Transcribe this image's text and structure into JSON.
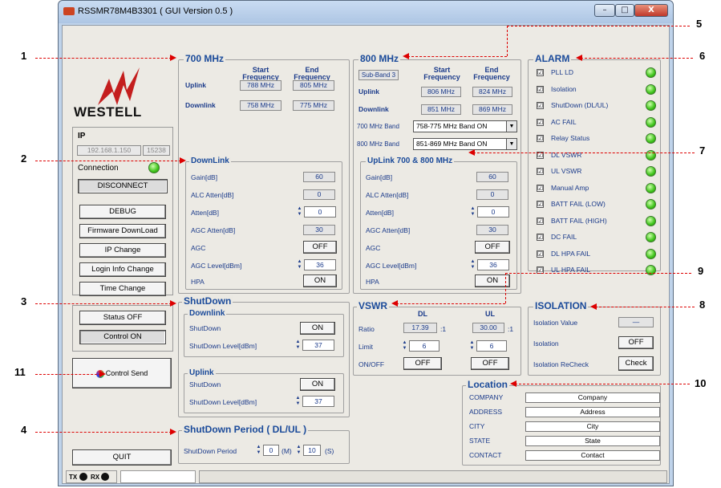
{
  "window": {
    "title": "RSSMR78M4B3301 ( GUI Version 0.5 )",
    "min": "–",
    "max": "□",
    "close": "X"
  },
  "logo": "WESTELL",
  "ip": {
    "label": "IP",
    "address": "192.168.1.150",
    "port": "15238"
  },
  "connection": {
    "label": "Connection",
    "disconnect": "DISCONNECT"
  },
  "left_buttons": {
    "debug": "DEBUG",
    "firmware": "Firmware DownLoad",
    "ip_change": "IP Change",
    "login": "Login Info Change",
    "time": "Time Change"
  },
  "status_off": "Status OFF",
  "control_on": "Control ON",
  "control_send": "Control Send",
  "quit": "QUIT",
  "statusbar": {
    "tx": "TX",
    "rx": "RX"
  },
  "mhz700": {
    "title": "700 MHz",
    "start_hdr": "Start\nFrequency",
    "end_hdr": "End\nFrequency",
    "uplink": "Uplink",
    "downlink": "Downlink",
    "ul_start": "788 MHz",
    "ul_end": "805 MHz",
    "dl_start": "758 MHz",
    "dl_end": "775 MHz"
  },
  "downlink": {
    "title": "DownLink",
    "gain_lbl": "Gain[dB]",
    "gain": "60",
    "alc_lbl": "ALC Atten[dB]",
    "alc": "0",
    "atten_lbl": "Atten[dB]",
    "atten": "0",
    "agc_atten_lbl": "AGC Atten[dB]",
    "agc_atten": "30",
    "agc_lbl": "AGC",
    "agc": "OFF",
    "agc_level_lbl": "AGC Level[dBm]",
    "agc_level": "36",
    "hpa_lbl": "HPA",
    "hpa": "ON"
  },
  "mhz800": {
    "title": "800 MHz",
    "subband": "Sub-Band 3",
    "uplink": "Uplink",
    "downlink": "Downlink",
    "ul_start": "806 MHz",
    "ul_end": "824 MHz",
    "dl_start": "851 MHz",
    "dl_end": "869 MHz",
    "band700_lbl": "700 MHz Band",
    "band700": "758-775 MHz Band ON",
    "band800_lbl": "800 MHz Band",
    "band800": "851-869 MHz Band ON"
  },
  "uplink": {
    "title": "UpLink 700 & 800 MHz",
    "gain": "60",
    "alc": "0",
    "atten": "0",
    "agc_atten": "30",
    "agc": "OFF",
    "agc_level": "36",
    "hpa": "ON"
  },
  "alarm": {
    "title": "ALARM",
    "items": [
      "PLL LD",
      "Isolation",
      "ShutDown (DL/UL)",
      "AC FAIL",
      "Relay Status",
      "DL VSWR",
      "UL VSWR",
      "Manual Amp",
      "BATT FAIL (LOW)",
      "BATT FAIL (HIGH)",
      "DC FAIL",
      "DL HPA FAIL",
      "UL HPA FAIL"
    ],
    "check": "☑",
    "led_color": "#3ec41a"
  },
  "shutdown": {
    "title": "ShutDown",
    "downlink": "Downlink",
    "uplink": "Uplink",
    "sd_lbl": "ShutDown",
    "sd_level_lbl": "ShutDown Level[dBm]",
    "dl_sd": "ON",
    "dl_level": "37",
    "ul_sd": "ON",
    "ul_level": "37"
  },
  "period": {
    "title": "ShutDown Period ( DL/UL )",
    "lbl": "ShutDown Period",
    "min": "0",
    "min_unit": "(M)",
    "sec": "10",
    "sec_unit": "(S)"
  },
  "vswr": {
    "title": "VSWR",
    "dl": "DL",
    "ul": "UL",
    "ratio_lbl": "Ratio",
    "limit_lbl": "Limit",
    "onoff_lbl": "ON/OFF",
    "dl_ratio": "17.39",
    "ul_ratio": "30.00",
    "ratio_unit": ":1",
    "dl_limit": "6",
    "ul_limit": "6",
    "dl_onoff": "OFF",
    "ul_onoff": "OFF"
  },
  "isolation": {
    "title": "ISOLATION",
    "value_lbl": "Isolation Value",
    "value": "—",
    "iso_lbl": "Isolation",
    "iso": "OFF",
    "recheck_lbl": "Isolation ReCheck",
    "check": "Check"
  },
  "location": {
    "title": "Location",
    "rows": [
      {
        "label": "COMPANY",
        "value": "Company"
      },
      {
        "label": "ADDRESS",
        "value": "Address"
      },
      {
        "label": "CITY",
        "value": "City"
      },
      {
        "label": "STATE",
        "value": "State"
      },
      {
        "label": "CONTACT",
        "value": "Contact"
      }
    ]
  },
  "callouts": [
    "1",
    "2",
    "3",
    "4",
    "5",
    "6",
    "7",
    "8",
    "9",
    "10",
    "11"
  ]
}
